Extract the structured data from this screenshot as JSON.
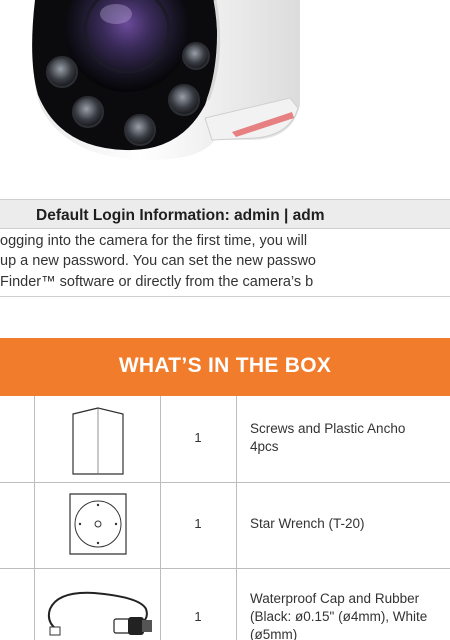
{
  "login": {
    "title": "Default Login Information: admin | adm",
    "lines": [
      "ogging into the camera for the first time, you will",
      " up a new password. You can set the new passwo",
      " Finder™ software or directly from the camera’s b"
    ]
  },
  "box": {
    "title": "WHAT’S IN THE BOX",
    "items": [
      {
        "icon": "folded-manual-icon",
        "qty": "1",
        "desc": [
          "Screws and Plastic Ancho",
          "4pcs"
        ]
      },
      {
        "icon": "mounting-template-icon",
        "qty": "1",
        "desc": [
          "Star Wrench (T-20)"
        ]
      },
      {
        "icon": "network-cable-icon",
        "qty": "1",
        "desc": [
          "Waterproof Cap and Rubber",
          "(Black: ø0.15\" (ø4mm), White",
          "(ø5mm)"
        ]
      }
    ]
  },
  "colors": {
    "accent": "#f07c2c",
    "bar": "#ececec",
    "border": "#bdbdbd"
  }
}
